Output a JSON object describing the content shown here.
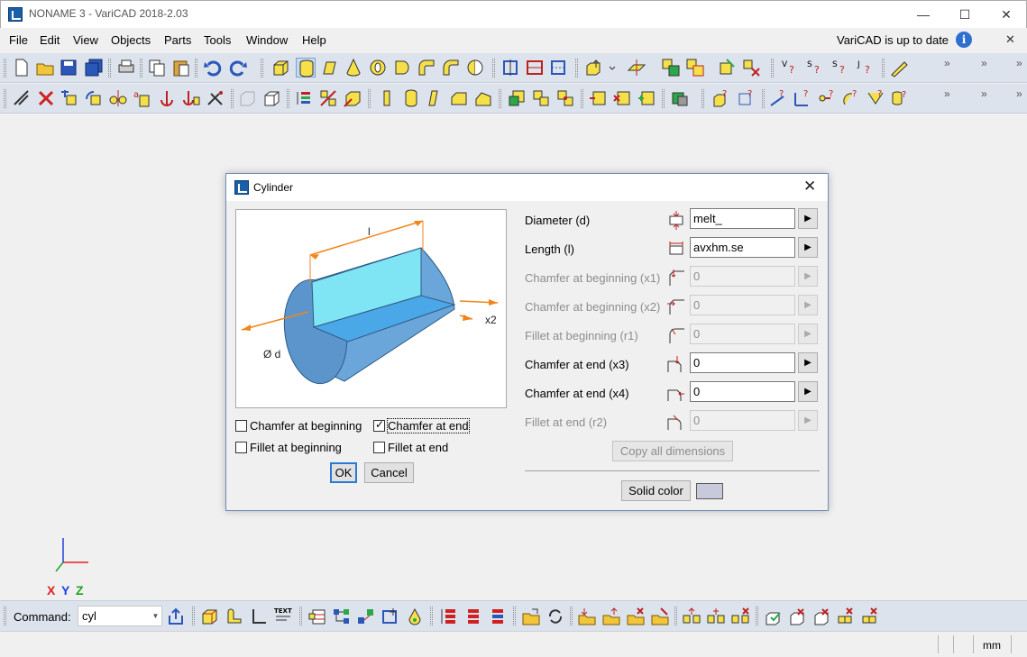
{
  "window": {
    "title": "NONAME 3 - VariCAD 2018-2.03",
    "minimize": "—",
    "maximize": "☐",
    "close": "✕"
  },
  "menu": {
    "items": [
      "File",
      "Edit",
      "View",
      "Objects",
      "Parts",
      "Tools",
      "Window",
      "Help"
    ],
    "status_message": "VariCAD is up to date",
    "info_icon": "i",
    "dismiss": "✕"
  },
  "toolbars": {
    "more_glyph": "»"
  },
  "axes": {
    "x_label": "X",
    "y_label": "Y",
    "z_label": "Z",
    "x_color": "#e02020",
    "y_color": "#2040e0",
    "z_color": "#20a020"
  },
  "command_bar": {
    "label": "Command:",
    "value": "cyl",
    "dropdown": "▼"
  },
  "status_bar": {
    "units": "mm"
  },
  "dialog": {
    "title": "Cylinder",
    "close": "✕",
    "preview": {
      "length_label": "l",
      "diameter_label": "Ø d",
      "x2_label": "x2",
      "body_color": "#6aa6da",
      "cut_color": "#7fe5f5"
    },
    "checkboxes": [
      {
        "label": "Chamfer at beginning",
        "checked": false
      },
      {
        "label": "Chamfer at end",
        "checked": true
      },
      {
        "label": "Fillet at beginning",
        "checked": false
      },
      {
        "label": "Fillet at end",
        "checked": false
      }
    ],
    "ok_label": "OK",
    "cancel_label": "Cancel",
    "params": [
      {
        "label": "Diameter (d)",
        "value": "melt_",
        "enabled": true
      },
      {
        "label": "Length (l)",
        "value": "avxhm.se",
        "enabled": true
      },
      {
        "label": "Chamfer at beginning (x1)",
        "value": "0",
        "enabled": false
      },
      {
        "label": "Chamfer at beginning (x2)",
        "value": "0",
        "enabled": false
      },
      {
        "label": "Fillet at beginning (r1)",
        "value": "0",
        "enabled": false
      },
      {
        "label": "Chamfer at end (x3)",
        "value": "0",
        "enabled": true
      },
      {
        "label": "Chamfer at end (x4)",
        "value": "0",
        "enabled": true
      },
      {
        "label": "Fillet at end (r2)",
        "value": "0",
        "enabled": false
      }
    ],
    "arrow_glyph": "▶",
    "copy_dims_label": "Copy all dimensions",
    "solid_color_label": "Solid color",
    "solid_color": "#c8cadc"
  }
}
